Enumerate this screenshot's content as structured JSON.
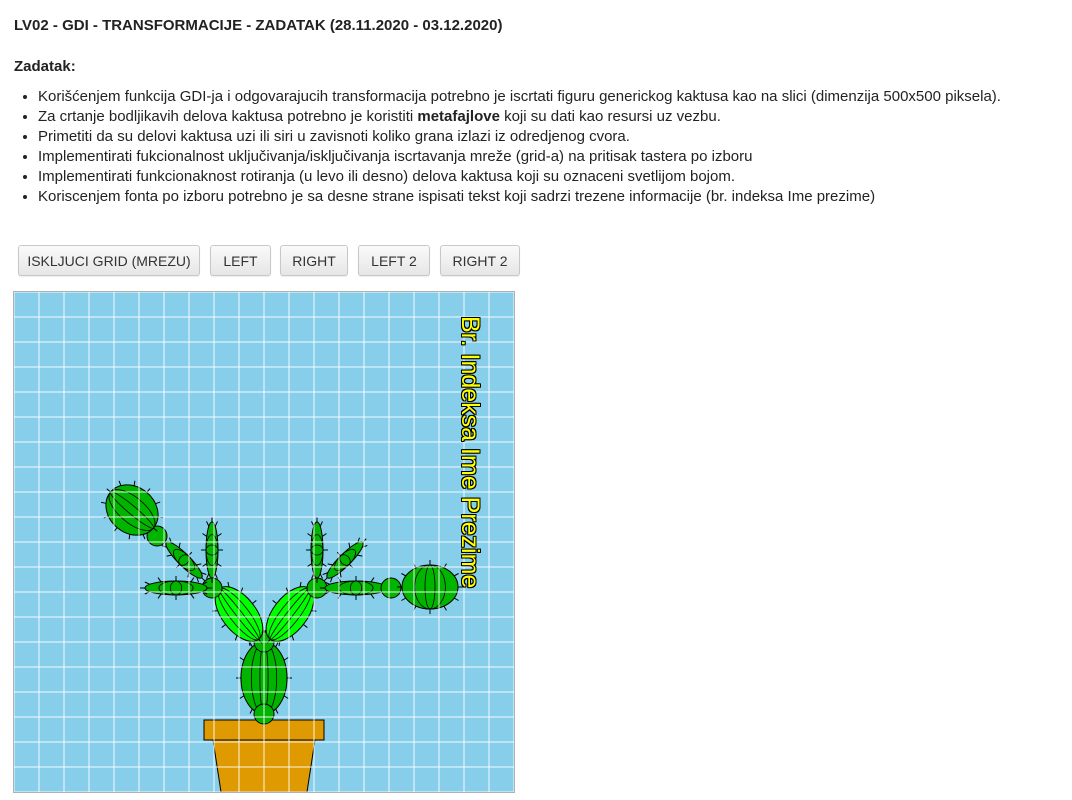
{
  "page": {
    "title": "LV02 - GDI - TRANSFORMACIJE - ZADATAK (28.11.2020 - 03.12.2020)",
    "subtitle": "Zadatak:"
  },
  "tasks": [
    {
      "text": "Korišćenjem funkcija GDI-ja i odgovarajucih transformacija potrebno je iscrtati figuru generickog kaktusa kao na slici (dimenzija 500x500 piksela)."
    },
    {
      "before": "Za crtanje bodljikavih delova kaktusa potrebno je koristiti ",
      "bold": "metafajlove",
      "after": " koji su dati kao resursi uz vezbu."
    },
    {
      "text": "Primetiti da su delovi kaktusa uzi ili siri u zavisnoti koliko grana izlazi iz odredjenog cvora."
    },
    {
      "text": "Implementirati fukcionalnost uključivanja/isključivanja iscrtavanja mreže (grid-a) na pritisak tastera po izboru"
    },
    {
      "text": "Implementirati funkcionaknost rotiranja (u levo ili desno) delova kaktusa koji su oznaceni svetlijom bojom."
    },
    {
      "text": "Koriscenjem fonta po izboru potrebno je sa desne strane ispisati tekst koji sadrzi trezene informacije (br. indeksa Ime prezime)"
    }
  ],
  "buttons": {
    "grid": "ISKLJUCI GRID (MREZU)",
    "left": "LEFT",
    "right": "RIGHT",
    "left2": "LEFT 2",
    "right2": "RIGHT 2"
  },
  "canvas": {
    "label": "Br. Indeksa Ime Prezime",
    "grid_visible": true,
    "grid_cells": 20,
    "colors": {
      "background": "#87ceeb",
      "grid_line": "#ffffff",
      "cactus_dark": "#00b400",
      "cactus_light": "#00ff00",
      "pot": "#de9a00",
      "label": "#ffff00",
      "outline": "#000000"
    }
  }
}
